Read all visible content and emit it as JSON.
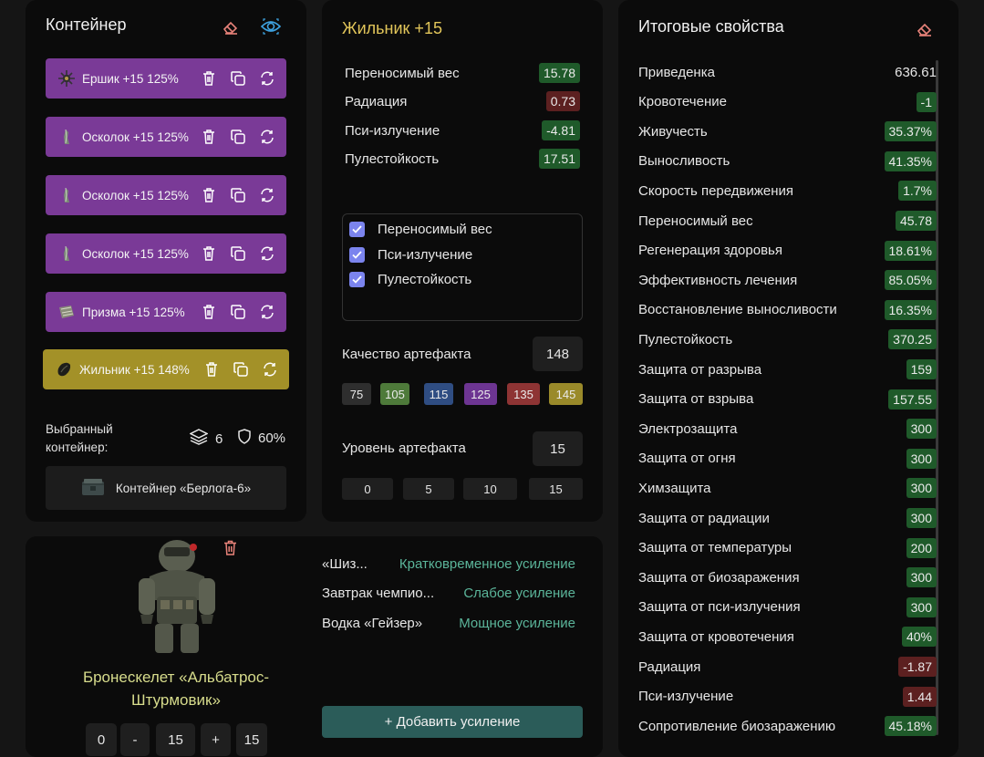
{
  "container_panel": {
    "title": "Контейнер",
    "artifacts": [
      {
        "label": "Ершик +15 125%",
        "icon": "ershik-artifact-icon"
      },
      {
        "label": "Осколок +15 125%",
        "icon": "shard-artifact-icon"
      },
      {
        "label": "Осколок +15 125%",
        "icon": "shard-artifact-icon"
      },
      {
        "label": "Осколок +15 125%",
        "icon": "shard-artifact-icon"
      },
      {
        "label": "Призма +15 125%",
        "icon": "prism-artifact-icon"
      },
      {
        "label": "Жильник +15 148%",
        "icon": "zhilnik-artifact-icon"
      }
    ],
    "selected_label": "Выбранный контейнер:",
    "slots": "6",
    "protection": "60%",
    "container_name": "Контейнер «Берлога-6»"
  },
  "artifact_panel": {
    "title": "Жильник +15",
    "props": [
      {
        "name": "Переносимый вес",
        "value": "15.78"
      },
      {
        "name": "Радиация",
        "value": "0.73"
      },
      {
        "name": "Пси-излучение",
        "value": "-4.81"
      },
      {
        "name": "Пулестойкость",
        "value": "17.51"
      }
    ],
    "checkboxes": [
      "Переносимый вес",
      "Пси-излучение",
      "Пулестойкость"
    ],
    "quality_label": "Качество артефакта",
    "quality_value": "148",
    "quality_options": [
      "75",
      "105",
      "115",
      "125",
      "135",
      "145"
    ],
    "level_label": "Уровень артефакта",
    "level_value": "15",
    "level_options": [
      "0",
      "5",
      "10",
      "15"
    ]
  },
  "totals_panel": {
    "title": "Итоговые свойства",
    "stats": [
      {
        "name": "Приведенка",
        "value": "636.61"
      },
      {
        "name": "Кровотечение",
        "value": "-1"
      },
      {
        "name": "Живучесть",
        "value": "35.37%"
      },
      {
        "name": "Выносливость",
        "value": "41.35%"
      },
      {
        "name": "Скорость передвижения",
        "value": "1.7%"
      },
      {
        "name": "Переносимый вес",
        "value": "45.78"
      },
      {
        "name": "Регенерация здоровья",
        "value": "18.61%"
      },
      {
        "name": "Эффективность лечения",
        "value": "85.05%"
      },
      {
        "name": "Восстановление выносливости",
        "value": "16.35%"
      },
      {
        "name": "Пулестойкость",
        "value": "370.25"
      },
      {
        "name": "Защита от разрыва",
        "value": "159"
      },
      {
        "name": "Защита от взрыва",
        "value": "157.55"
      },
      {
        "name": "Электрозащита",
        "value": "300"
      },
      {
        "name": "Защита от огня",
        "value": "300"
      },
      {
        "name": "Химзащита",
        "value": "300"
      },
      {
        "name": "Защита от радиации",
        "value": "300"
      },
      {
        "name": "Защита от температуры",
        "value": "200"
      },
      {
        "name": "Защита от биозаражения",
        "value": "300"
      },
      {
        "name": "Защита от пси-излучения",
        "value": "300"
      },
      {
        "name": "Защита от кровотечения",
        "value": "40%"
      },
      {
        "name": "Радиация",
        "value": "-1.87"
      },
      {
        "name": "Пси-излучение",
        "value": "1.44"
      },
      {
        "name": "Сопротивление биозаражению",
        "value": "45.18%"
      }
    ]
  },
  "armor_panel": {
    "name": "Бронескелет «Альбатрос-Штурмовик»",
    "stepper": {
      "min": "0",
      "minus": "-",
      "value": "15",
      "plus": "+",
      "max": "15"
    },
    "boosts": [
      {
        "name": "«Шиз...",
        "type": "Кратковременное усиление"
      },
      {
        "name": "Завтрак чемпио...",
        "type": "Слабое усиление"
      },
      {
        "name": "Водка «Гейзер»",
        "type": "Мощное усиление"
      }
    ],
    "add_button": "+ Добавить усиление"
  },
  "colors": {
    "purple": "#7a3a97",
    "gold": "#a39128",
    "green_badge": "#1f5a2a",
    "red_badge": "#5c2020",
    "accent_gold_text": "#e2c65a",
    "boost_text": "#5bb59a"
  }
}
